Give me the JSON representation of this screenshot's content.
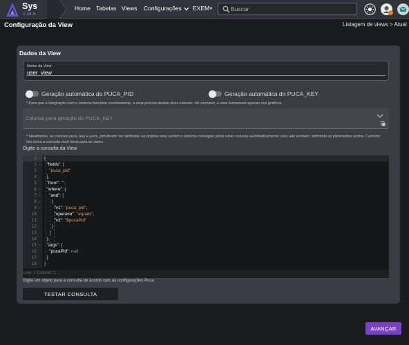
{
  "app": {
    "name": "Sys",
    "version": "2.34.5"
  },
  "nav": {
    "items": [
      "Home",
      "Tabelas",
      "Views",
      "Configurações",
      "EXEMP"
    ],
    "more": "»",
    "search_placeholder": "Buscar"
  },
  "header": {
    "title": "Configuração da View",
    "breadcrumb": "Listagem de views  >  Atual"
  },
  "form": {
    "section_title": "Dados da View",
    "name_label": "Nome da View",
    "name_value": "user_view_",
    "toggle_pid_label": "Geração automática do PUCA_PID",
    "toggle_key_label": "Geração automática do PUCA_KEY",
    "hint_integration": "* Para que a integração com o sistema funcione corretamente, a view precisa destas duas colunas, do contrário, a view funcionará apenas nos gráficos.",
    "columns_placeholder": "Colunas para geração do PUCA_KEY",
    "hint_columns": "* Idealmente, as colunas puca_key e puca_pid devem ser definidas na própria view, porém o sistema consegue gerar estas colunas automaticamente caso não existam, definindo os parâmetros acima. Contudo isto torna a consulta mais lenta para as views.",
    "query_label": "Digite a consulta da View",
    "code_hint": "Digite um objeto para a consulta de acordo com as configurações Puca"
  },
  "editor": {
    "status": "Line: 1    Column: 1",
    "line_numbers": [
      "1",
      "2",
      "3",
      "4",
      "5",
      "6",
      "7",
      "8",
      "9",
      "10",
      "11",
      "12",
      "13",
      "14",
      "15",
      "16",
      "17",
      "18"
    ],
    "folded_lines": [
      "1",
      "2",
      "6",
      "7",
      "8",
      "9",
      "15"
    ]
  },
  "buttons": {
    "test": "TESTAR CONSULTA",
    "advance": "AVANÇAR"
  },
  "colors": {
    "accent": "#7c3fc7",
    "background": "#1b1c1f",
    "card": "#3a3d43"
  },
  "icons": [
    "logo-icon",
    "search-icon",
    "brightness-icon",
    "user-settings-icon",
    "notifications-icon",
    "chevron-down-icon",
    "copy-icon"
  ]
}
